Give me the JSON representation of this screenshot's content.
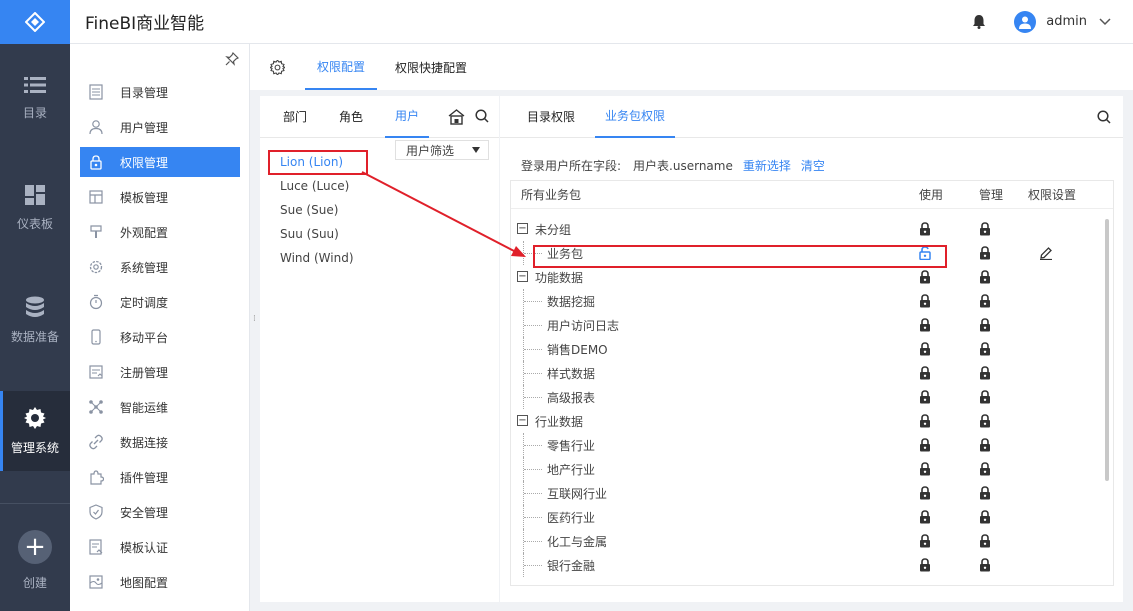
{
  "app": {
    "title": "FineBI商业智能"
  },
  "header": {
    "username": "admin"
  },
  "rail": {
    "items": [
      {
        "label": "目录",
        "icon": "list-icon"
      },
      {
        "label": "仪表板",
        "icon": "dashboard-icon"
      },
      {
        "label": "数据准备",
        "icon": "database-icon"
      },
      {
        "label": "管理系统",
        "icon": "gear-icon"
      }
    ],
    "create_label": "创建"
  },
  "menu": {
    "items": [
      {
        "label": "目录管理",
        "icon": "catalog-icon"
      },
      {
        "label": "用户管理",
        "icon": "user-icon"
      },
      {
        "label": "权限管理",
        "icon": "lock-icon"
      },
      {
        "label": "模板管理",
        "icon": "template-icon"
      },
      {
        "label": "外观配置",
        "icon": "brush-icon"
      },
      {
        "label": "系统管理",
        "icon": "gear-icon"
      },
      {
        "label": "定时调度",
        "icon": "timer-icon"
      },
      {
        "label": "移动平台",
        "icon": "mobile-icon"
      },
      {
        "label": "注册管理",
        "icon": "register-icon"
      },
      {
        "label": "智能运维",
        "icon": "network-icon"
      },
      {
        "label": "数据连接",
        "icon": "link-icon"
      },
      {
        "label": "插件管理",
        "icon": "plugin-icon"
      },
      {
        "label": "安全管理",
        "icon": "shield-icon"
      },
      {
        "label": "模板认证",
        "icon": "certify-icon"
      },
      {
        "label": "地图配置",
        "icon": "map-icon"
      }
    ],
    "active_index": 2
  },
  "tabs": {
    "primary": "权限配置",
    "secondary": "权限快捷配置"
  },
  "users_panel": {
    "tabs": [
      "部门",
      "角色",
      "用户"
    ],
    "filter_label": "用户筛选",
    "users": [
      "Lion (Lion)",
      "Luce (Luce)",
      "Sue (Sue)",
      "Suu (Suu)",
      "Wind (Wind)"
    ]
  },
  "perm_panel": {
    "tabs": [
      "目录权限",
      "业务包权限"
    ],
    "login_label": "登录用户所在字段:",
    "login_field": "用户表.username",
    "reselect": "重新选择",
    "clear": "清空",
    "columns": [
      "所有业务包",
      "使用",
      "管理",
      "权限设置"
    ],
    "rows": [
      {
        "name": "未分组",
        "level": 0,
        "group": true
      },
      {
        "name": "业务包",
        "level": 1,
        "unlocked": true,
        "editable": true
      },
      {
        "name": "功能数据",
        "level": 0,
        "group": true
      },
      {
        "name": "数据挖掘",
        "level": 1
      },
      {
        "name": "用户访问日志",
        "level": 1
      },
      {
        "name": "销售DEMO",
        "level": 1
      },
      {
        "name": "样式数据",
        "level": 1
      },
      {
        "name": "高级报表",
        "level": 1
      },
      {
        "name": "行业数据",
        "level": 0,
        "group": true
      },
      {
        "name": "零售行业",
        "level": 1
      },
      {
        "name": "地产行业",
        "level": 1
      },
      {
        "name": "互联网行业",
        "level": 1
      },
      {
        "name": "医药行业",
        "level": 1
      },
      {
        "name": "化工与金属",
        "level": 1
      },
      {
        "name": "银行金融",
        "level": 1
      }
    ]
  },
  "colors": {
    "accent": "#3685f2",
    "rail_bg": "#323b4d",
    "highlight": "#e0202a"
  }
}
